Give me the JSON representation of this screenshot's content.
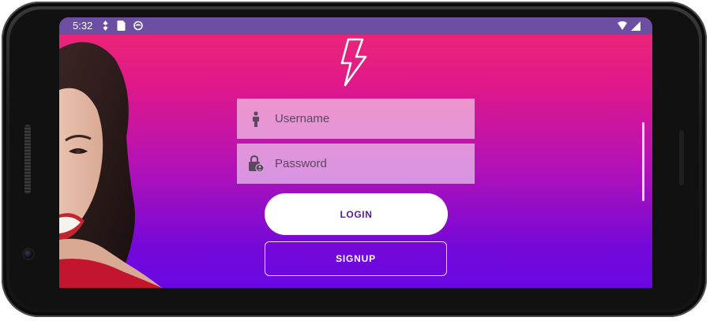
{
  "status_bar": {
    "time": "5:32",
    "icons_left": [
      "location-icon",
      "sim-card-icon",
      "sync-icon"
    ],
    "icons_right": [
      "wifi-icon",
      "cell-signal-icon"
    ]
  },
  "app": {
    "logo_icon": "lightning-bolt-icon",
    "username_placeholder": "Username",
    "password_placeholder": "Password",
    "login_label": "LOGIN",
    "signup_label": "SIGNUP"
  },
  "colors": {
    "gradient_top": "#ee2a72",
    "gradient_bottom": "#6a08e3",
    "status_bar": "#6c4fa3",
    "login_text": "#5a1a9e"
  }
}
